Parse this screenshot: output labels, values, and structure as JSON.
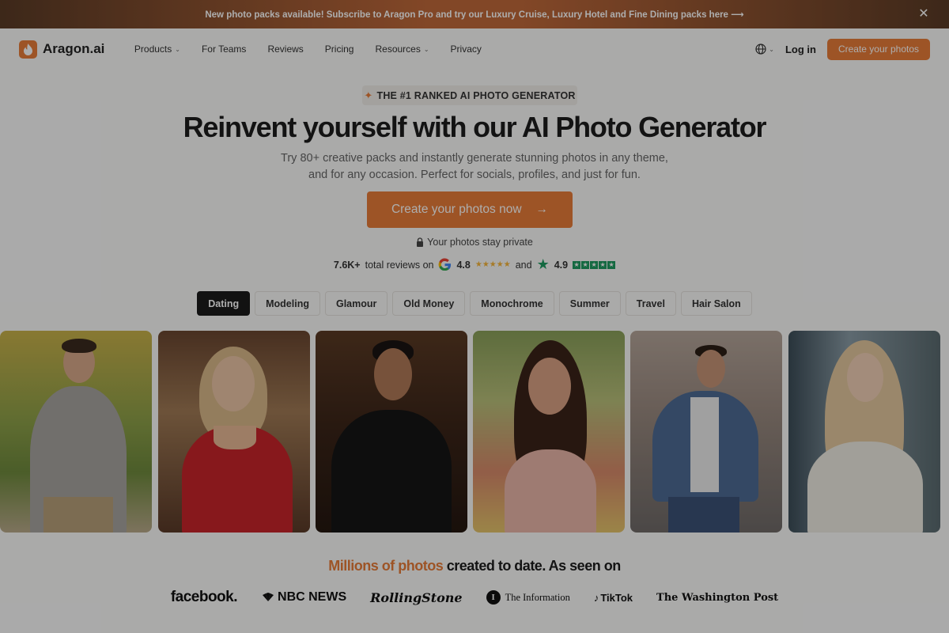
{
  "banner": {
    "text": "New photo packs available! Subscribe to Aragon Pro and try our Luxury Cruise, Luxury Hotel and Fine Dining packs here ⟶",
    "close_icon": "close-icon"
  },
  "nav": {
    "logo_text": "Aragon.ai",
    "links": [
      {
        "label": "Products",
        "dropdown": true
      },
      {
        "label": "For Teams",
        "dropdown": false
      },
      {
        "label": "Reviews",
        "dropdown": false
      },
      {
        "label": "Pricing",
        "dropdown": false
      },
      {
        "label": "Resources",
        "dropdown": true
      },
      {
        "label": "Privacy",
        "dropdown": false
      }
    ],
    "login": "Log in",
    "cta": "Create your photos"
  },
  "hero": {
    "badge": "THE #1 RANKED AI PHOTO GENERATOR",
    "headline": "Reinvent yourself with our AI Photo Generator",
    "sub_line1": "Try 80+ creative packs and instantly generate stunning photos in any theme,",
    "sub_line2": "and for any occasion. Perfect for socials, profiles, and just for fun.",
    "cta": "Create your photos now",
    "cta_arrow": "→",
    "private": "Your photos stay private"
  },
  "reviews": {
    "count": "7.6K+",
    "text": "total reviews on",
    "google_rating": "4.8",
    "and": "and",
    "trustpilot_rating": "4.9"
  },
  "tabs": [
    {
      "label": "Dating",
      "active": true
    },
    {
      "label": "Modeling",
      "active": false
    },
    {
      "label": "Glamour",
      "active": false
    },
    {
      "label": "Old Money",
      "active": false
    },
    {
      "label": "Monochrome",
      "active": false
    },
    {
      "label": "Summer",
      "active": false
    },
    {
      "label": "Travel",
      "active": false
    },
    {
      "label": "Hair Salon",
      "active": false
    }
  ],
  "press": {
    "headline_accent": "Millions of photos",
    "headline_rest": " created to date. As seen on",
    "logos": [
      "facebook.",
      "NBC NEWS",
      "RollingStone",
      "The Information",
      "TikTok",
      "The Washington Post"
    ]
  },
  "colors": {
    "accent": "#e87c38",
    "active_tab": "#1b1b1b"
  }
}
